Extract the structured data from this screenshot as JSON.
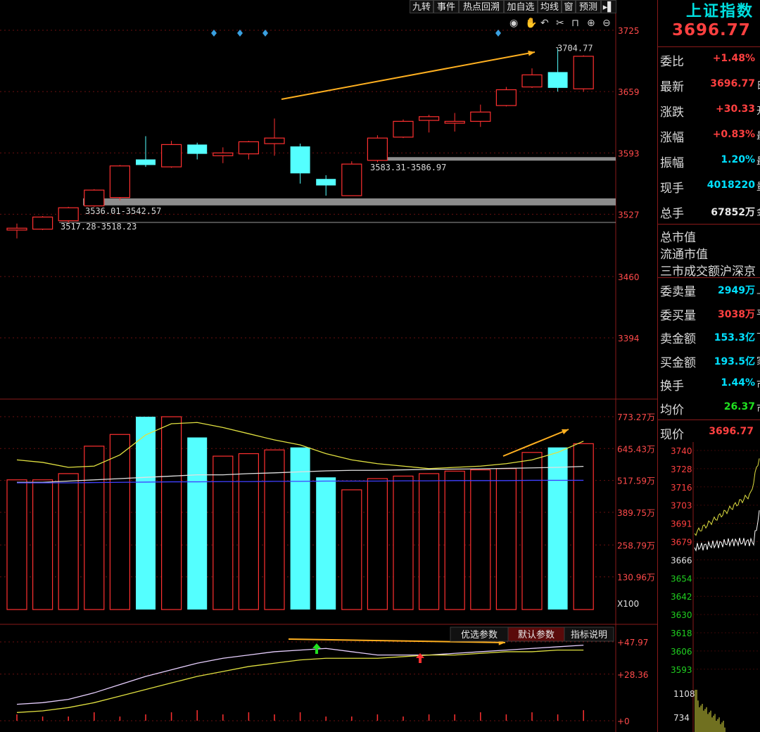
{
  "toolbar": {
    "buttons": [
      "九转",
      "事件",
      "热点回溯",
      "加自选",
      "均线",
      "窗",
      "预测"
    ]
  },
  "price_axis": [
    "3725",
    "3659",
    "3593",
    "3527",
    "3460",
    "3394"
  ],
  "volume_axis": [
    "773.27万",
    "645.43万",
    "517.59万",
    "389.75万",
    "258.79万",
    "130.96万",
    "X100"
  ],
  "indicator_axis": [
    "47.97",
    "28.36",
    "0"
  ],
  "indicator_tabs": [
    "优选参数",
    "默认参数",
    "指标说明"
  ],
  "annotations": {
    "high": "3704.77",
    "gap1": "3583.31-3586.97",
    "gap2": "3536.01-3542.57",
    "gap3": "3517.28-3518.23"
  },
  "chart_data": {
    "type": "candlestick",
    "candles": [
      {
        "o": 3510,
        "c": 3512,
        "h": 3517,
        "l": 3501,
        "dir": "up"
      },
      {
        "o": 3511,
        "c": 3524,
        "h": 3525,
        "l": 3510,
        "dir": "up"
      },
      {
        "o": 3520,
        "c": 3534,
        "h": 3535,
        "l": 3518,
        "dir": "up"
      },
      {
        "o": 3536,
        "c": 3553,
        "h": 3554,
        "l": 3535,
        "dir": "up"
      },
      {
        "o": 3545,
        "c": 3579,
        "h": 3580,
        "l": 3542,
        "dir": "up"
      },
      {
        "o": 3586,
        "c": 3580,
        "h": 3611,
        "l": 3578,
        "dir": "down"
      },
      {
        "o": 3578,
        "c": 3602,
        "h": 3606,
        "l": 3577,
        "dir": "up"
      },
      {
        "o": 3602,
        "c": 3592,
        "h": 3604,
        "l": 3586,
        "dir": "down"
      },
      {
        "o": 3590,
        "c": 3593,
        "h": 3599,
        "l": 3582,
        "dir": "up"
      },
      {
        "o": 3592,
        "c": 3605,
        "h": 3606,
        "l": 3586,
        "dir": "up"
      },
      {
        "o": 3603,
        "c": 3609,
        "h": 3630,
        "l": 3590,
        "dir": "up"
      },
      {
        "o": 3600,
        "c": 3571,
        "h": 3603,
        "l": 3560,
        "dir": "down"
      },
      {
        "o": 3565,
        "c": 3558,
        "h": 3569,
        "l": 3547,
        "dir": "down"
      },
      {
        "o": 3547,
        "c": 3581,
        "h": 3584,
        "l": 3547,
        "dir": "up"
      },
      {
        "o": 3585,
        "c": 3609,
        "h": 3612,
        "l": 3583,
        "dir": "up"
      },
      {
        "o": 3610,
        "c": 3627,
        "h": 3629,
        "l": 3609,
        "dir": "up"
      },
      {
        "o": 3628,
        "c": 3632,
        "h": 3634,
        "l": 3615,
        "dir": "up"
      },
      {
        "o": 3625,
        "c": 3627,
        "h": 3636,
        "l": 3616,
        "dir": "up"
      },
      {
        "o": 3627,
        "c": 3637,
        "h": 3645,
        "l": 3621,
        "dir": "up"
      },
      {
        "o": 3644,
        "c": 3661,
        "h": 3664,
        "l": 3643,
        "dir": "up"
      },
      {
        "o": 3664,
        "c": 3677,
        "h": 3684,
        "l": 3663,
        "dir": "up"
      },
      {
        "o": 3680,
        "c": 3663,
        "h": 3705,
        "l": 3659,
        "dir": "down"
      },
      {
        "o": 3662,
        "c": 3697,
        "h": 3698,
        "l": 3659,
        "dir": "up"
      }
    ],
    "volumes": [
      520,
      520,
      545,
      655,
      702,
      773,
      773,
      690,
      615,
      625,
      640,
      650,
      530,
      480,
      525,
      535,
      545,
      555,
      560,
      565,
      630,
      650,
      665
    ],
    "volume_ma1": [
      600,
      590,
      570,
      575,
      620,
      700,
      745,
      750,
      730,
      705,
      680,
      660,
      625,
      600,
      585,
      575,
      565,
      570,
      575,
      585,
      600,
      630,
      675
    ],
    "volume_ma2": [
      510,
      510,
      515,
      520,
      525,
      530,
      535,
      540,
      540,
      545,
      548,
      552,
      556,
      558,
      558,
      560,
      562,
      563,
      564,
      566,
      568,
      570,
      574
    ],
    "volume_ma3": [
      508,
      508,
      508,
      509,
      510,
      511,
      512,
      512,
      513,
      513,
      514,
      514,
      515,
      515,
      515,
      516,
      516,
      517,
      517,
      517,
      518,
      518,
      518
    ],
    "indicator_line1": [
      10,
      11,
      13,
      17,
      22,
      27,
      31,
      35,
      38,
      40,
      42,
      43,
      44,
      42,
      40,
      40,
      40,
      41,
      42,
      43,
      44,
      45,
      46
    ],
    "indicator_line2": [
      5,
      6,
      8,
      11,
      15,
      19,
      23,
      27,
      30,
      33,
      35,
      37,
      38,
      38,
      38,
      39,
      40,
      40,
      41,
      42,
      42,
      43,
      43
    ],
    "indicator_bars": [
      3,
      2,
      2,
      4,
      2,
      3,
      4,
      5,
      3,
      4,
      3,
      4,
      2,
      2,
      3,
      2,
      3,
      3,
      4,
      3,
      4,
      3,
      5
    ],
    "colors": {
      "up": "#ff3030",
      "down": "#54ffff",
      "grid": "#6a1010",
      "ma1": "#e0e040",
      "ma2": "#e0e0e0",
      "ma3": "#4040ff",
      "arrow": "#ffb020"
    }
  },
  "right_panel": {
    "title": "上证指数",
    "price": "3696.77",
    "rows": [
      {
        "label": "委比",
        "value": "+1.48%",
        "color": "red",
        "tail": ""
      },
      {
        "label": "最新",
        "value": "3696.77",
        "color": "red",
        "tail": "日"
      },
      {
        "label": "涨跌",
        "value": "+30.33",
        "color": "red",
        "tail": "开"
      },
      {
        "label": "涨幅",
        "value": "+0.83%",
        "color": "red",
        "tail": "最"
      },
      {
        "label": "振幅",
        "value": "1.20%",
        "color": "cyan",
        "tail": "最"
      },
      {
        "label": "现手",
        "value": "4018220",
        "color": "cyan",
        "tail": "量"
      },
      {
        "label": "总手",
        "value": "67852万",
        "color": "white",
        "tail": "金"
      }
    ],
    "plain_rows": [
      "总市值",
      "流通市值",
      "三市成交额沪深京"
    ],
    "rows2": [
      {
        "label": "委卖量",
        "value": "2949万",
        "color": "cyan",
        "tail": "上"
      },
      {
        "label": "委买量",
        "value": "3038万",
        "color": "red",
        "tail": "平"
      },
      {
        "label": "卖金额",
        "value": "153.3亿",
        "color": "cyan",
        "tail": "下"
      },
      {
        "label": "买金额",
        "value": "193.5亿",
        "color": "cyan",
        "tail": "家"
      },
      {
        "label": "换手",
        "value": "1.44%",
        "color": "cyan",
        "tail": "市"
      },
      {
        "label": "均价",
        "value": "26.37",
        "color": "green",
        "tail": "市"
      }
    ],
    "mini_chart": {
      "current_label": "现价",
      "current_value": "3696.77",
      "price_ticks": [
        "3740",
        "3728",
        "3716",
        "3703",
        "3691",
        "3679",
        "3666",
        "3654",
        "3642",
        "3630",
        "3618",
        "3606",
        "3593"
      ],
      "volume_ticks": [
        "1108",
        "734"
      ]
    }
  }
}
